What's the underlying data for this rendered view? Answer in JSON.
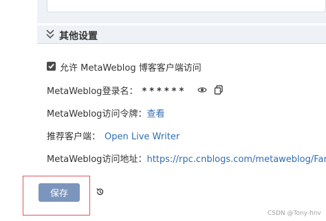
{
  "section": {
    "title": "其他设置"
  },
  "settings": {
    "allow_label": "允许 MetaWeblog 博客客户端访问",
    "username_label": "MetaWeblog登录名：",
    "username_value": "******",
    "token_label": "MetaWeblog访问令牌：",
    "token_link": "查看",
    "client_label": "推荐客户端：",
    "client_link": "Open Live Writer",
    "address_label": "MetaWeblog访问地址：",
    "address_link": "https://rpc.cnblogs.com/metaweblog/Fanw"
  },
  "actions": {
    "save_label": "保存"
  },
  "watermark": "CSDN @Tony-hnv",
  "icons": [
    "chevron-double-down-icon",
    "checkbox-checked-icon",
    "eye-icon",
    "copy-icon",
    "history-icon"
  ],
  "colors": {
    "link": "#2e6db4",
    "save_button": "#7b95bd",
    "highlight": "#e0525a",
    "header_bg": "#eef2f7"
  }
}
